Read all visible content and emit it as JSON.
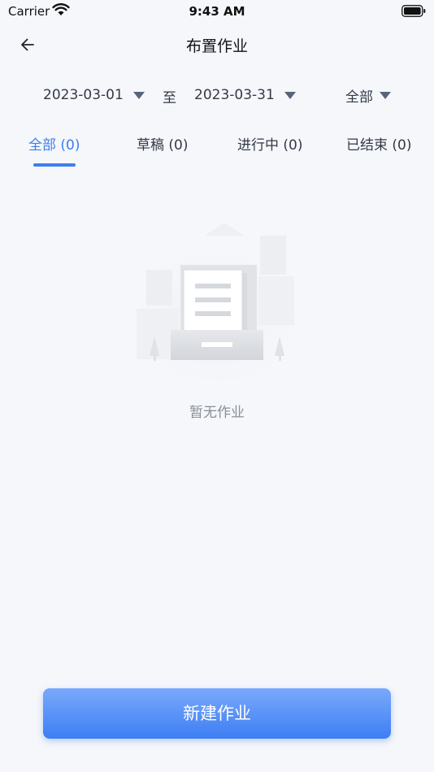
{
  "status_bar": {
    "carrier": "Carrier",
    "time": "9:43 AM"
  },
  "nav": {
    "title": "布置作业",
    "back_icon": "arrow-left-icon"
  },
  "filters": {
    "start_date": "2023-03-01",
    "separator": "至",
    "end_date": "2023-03-31",
    "scope": "全部"
  },
  "tabs": [
    {
      "label": "全部 (0)",
      "active": true
    },
    {
      "label": "草稿 (0)",
      "active": false
    },
    {
      "label": "进行中 (0)",
      "active": false
    },
    {
      "label": "已结束 (0)",
      "active": false
    }
  ],
  "empty_state": {
    "icon": "empty-document-illustration",
    "message": "暂无作业"
  },
  "primary_action": {
    "label": "新建作业"
  },
  "colors": {
    "accent": "#3c7ef0",
    "background": "#f5f7fb",
    "button_gradient_top": "#7aa9fb",
    "button_gradient_bottom": "#3d7ef4"
  }
}
